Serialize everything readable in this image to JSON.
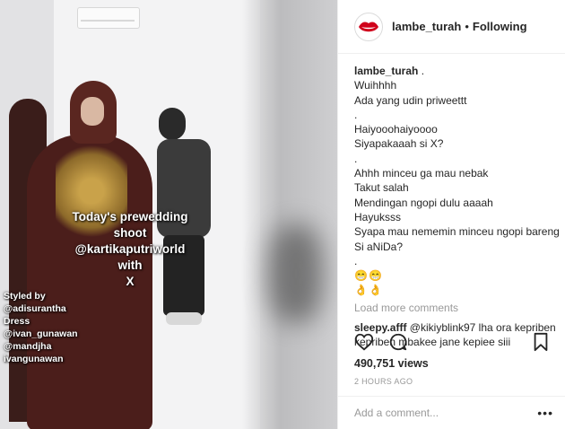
{
  "media": {
    "overlay_caption": [
      "Today's prewedding",
      "shoot",
      "@kartikaputriworld",
      "with",
      "X"
    ],
    "credits": [
      "Styled by",
      "@adisurantha",
      "Dress",
      "@ivan_gunawan",
      "@mandjha",
      "ivangunawan"
    ]
  },
  "header": {
    "username": "lambe_turah",
    "separator": "•",
    "follow_status": "Following",
    "avatar_icon": "lips-avatar-icon"
  },
  "post": {
    "author": "lambe_turah",
    "caption_lines": [
      " .",
      "Wuihhhh",
      "Ada yang udin priweettt",
      ".",
      "Haiyooohaiyoooo",
      "Siyapakaaah si X?",
      ".",
      "Ahhh minceu ga mau nebak",
      "Takut salah",
      "Mendingan ngopi dulu aaaah",
      "Hayuksss",
      "Syapa mau nememin minceu ngopi bareng",
      "Si aNiDa?",
      ".",
      "😁😁",
      "👌👌"
    ],
    "load_more": "Load more comments",
    "reply": {
      "author": "sleepy.afff",
      "line1": " @kikiyblink97 lha ora kepriben",
      "line2": "kepriben mbakee jane kepiee siii"
    }
  },
  "actions": {
    "like_icon": "heart-icon",
    "comment_icon": "comment-bubble-icon",
    "save_icon": "bookmark-icon"
  },
  "stats": {
    "views": "490,751 views",
    "time": "2 HOURS AGO"
  },
  "comment_box": {
    "placeholder": "Add a comment...",
    "more_label": "•••"
  }
}
